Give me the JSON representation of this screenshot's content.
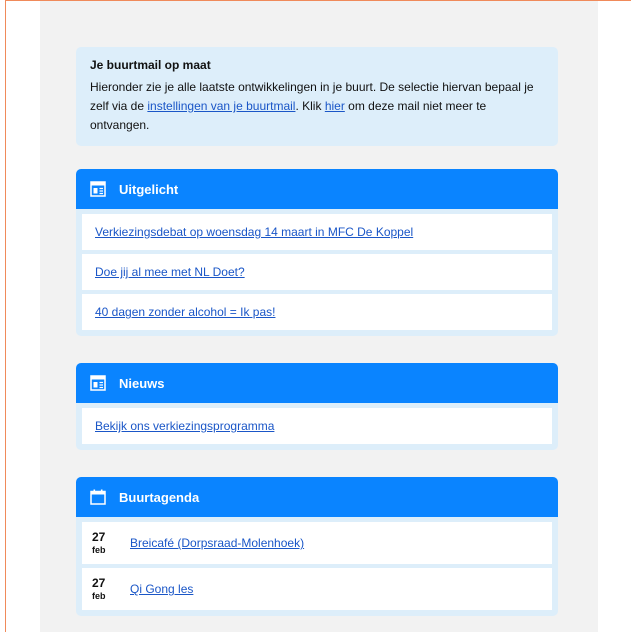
{
  "intro": {
    "title": "Je buurtmail op maat",
    "text_1": "Hieronder zie je alle laatste ontwikkelingen in je buurt. De selectie hiervan bepaal je zelf via de ",
    "link_settings": "instellingen van je buurtmail",
    "text_2": ". Klik ",
    "link_here": "hier",
    "text_3": " om deze mail niet meer te ontvangen."
  },
  "sections": {
    "featured": {
      "title": "Uitgelicht",
      "icon": "newspaper-icon",
      "items": [
        "Verkiezingsdebat op woensdag 14 maart in MFC De Koppel",
        "Doe jij al mee met NL Doet?",
        "40 dagen zonder alcohol = Ik pas!"
      ]
    },
    "news": {
      "title": "Nieuws",
      "icon": "newspaper-icon",
      "items": [
        "Bekijk ons verkiezingsprogramma"
      ]
    },
    "agenda": {
      "title": "Buurtagenda",
      "icon": "calendar-icon",
      "items": [
        {
          "day": "27",
          "month": "feb",
          "title": "Breicafé (Dorpsraad-Molenhoek)"
        },
        {
          "day": "27",
          "month": "feb",
          "title": "Qi Gong les"
        }
      ]
    }
  },
  "colors": {
    "accent": "#0a84ff",
    "panel": "#ddeefa",
    "link": "#1a56c7",
    "frame": "#f08a5a"
  }
}
